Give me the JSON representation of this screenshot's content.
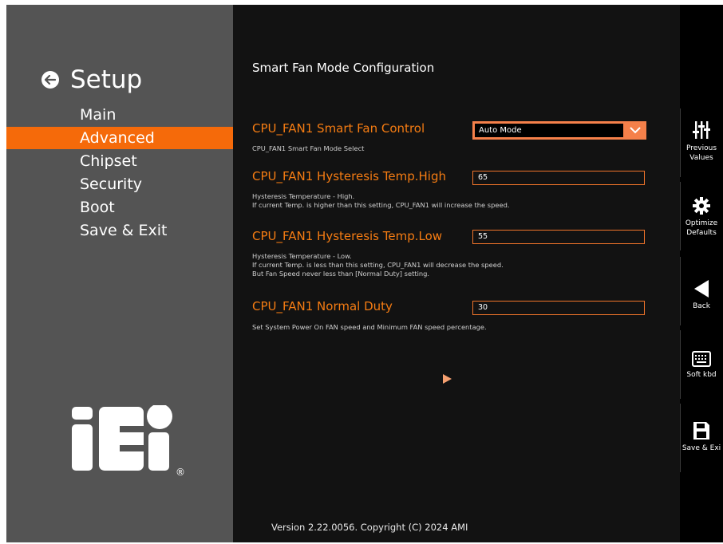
{
  "sidebar": {
    "title": "Setup",
    "items": [
      {
        "label": "Main",
        "active": false
      },
      {
        "label": "Advanced",
        "active": true
      },
      {
        "label": "Chipset",
        "active": false
      },
      {
        "label": "Security",
        "active": false
      },
      {
        "label": "Boot",
        "active": false
      },
      {
        "label": "Save & Exit",
        "active": false
      }
    ],
    "logo_text": "iEi",
    "logo_mark": "®"
  },
  "main": {
    "title": "Smart Fan Mode Configuration",
    "settings": [
      {
        "label": "CPU_FAN1 Smart Fan Control",
        "value": "Auto Mode",
        "help": "CPU_FAN1 Smart Fan Mode Select"
      },
      {
        "label": "CPU_FAN1 Hysteresis Temp.High",
        "value": "65",
        "help": "Hysteresis Temperature - High.\nIf current Temp. is higher than this setting, CPU_FAN1 will increase the speed."
      },
      {
        "label": "CPU_FAN1 Hysteresis Temp.Low",
        "value": "55",
        "help": "Hysteresis Temperature - Low.\nIf current Temp. is less than this setting, CPU_FAN1 will decrease the speed.\nBut Fan Speed never less than [Normal Duty] setting."
      },
      {
        "label": "CPU_FAN1 Normal Duty",
        "value": "30",
        "help": "Set System Power On FAN speed and Minimum FAN speed percentage."
      }
    ],
    "version": "Version 2.22.0056. Copyright (C) 2024 AMI"
  },
  "toolbar": {
    "previous_values": "Previous\nValues",
    "optimized_defaults": "Optimize\nDefaults",
    "back": "Back",
    "soft_kbd": "Soft kbd",
    "save_exit": "Save & Exi"
  },
  "colors": {
    "accent": "#f56a0a",
    "label": "#f57c12",
    "panel": "#545454",
    "background": "#121212"
  }
}
